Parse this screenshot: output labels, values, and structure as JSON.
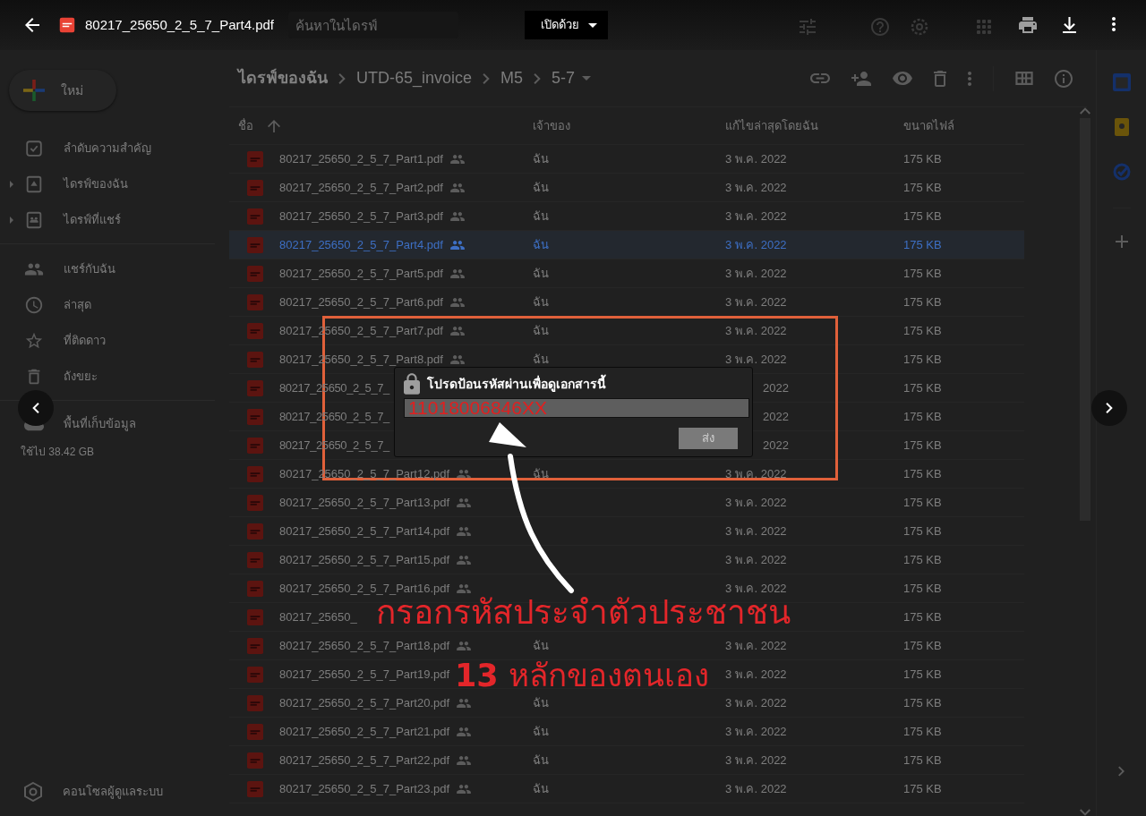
{
  "viewer": {
    "file_name": "80217_25650_2_5_7_Part4.pdf",
    "open_with": "เปิดด้วย"
  },
  "drive_header": {
    "search_placeholder": "ค้นหาในไดรฟ์"
  },
  "sidebar": {
    "new_button": "ใหม่",
    "groups": [
      [
        {
          "label": "ลำดับความสำคัญ"
        },
        {
          "label": "ไดรฟ์ของฉัน",
          "expanded": false
        },
        {
          "label": "ไดรฟ์ที่แชร์",
          "expanded": false
        }
      ],
      [
        {
          "label": "แชร์กับฉัน"
        },
        {
          "label": "ล่าสุด"
        },
        {
          "label": "ที่ติดดาว"
        },
        {
          "label": "ถังขยะ"
        }
      ]
    ],
    "storage": {
      "label": "พื้นที่เก็บข้อมูล",
      "used": "ใช้ไป 38.42 GB"
    },
    "admin": "คอนโซลผู้ดูแลระบบ"
  },
  "breadcrumb": [
    "ไดรฟ์ของฉัน",
    "UTD-65_invoice",
    "M5",
    "5-7"
  ],
  "table": {
    "columns": [
      "ชื่อ",
      "เจ้าของ",
      "แก้ไขล่าสุดโดยฉัน",
      "ขนาดไฟล์"
    ],
    "rows": [
      {
        "kind": "full",
        "name": "80217_25650_2_5_7_Part1.pdf",
        "owner": "ฉัน",
        "modified": "3 พ.ค. 2022",
        "size": "175 KB",
        "selected": false
      },
      {
        "kind": "full",
        "name": "80217_25650_2_5_7_Part2.pdf",
        "owner": "ฉัน",
        "modified": "3 พ.ค. 2022",
        "size": "175 KB",
        "selected": false
      },
      {
        "kind": "full",
        "name": "80217_25650_2_5_7_Part3.pdf",
        "owner": "ฉัน",
        "modified": "3 พ.ค. 2022",
        "size": "175 KB",
        "selected": false
      },
      {
        "kind": "full",
        "name": "80217_25650_2_5_7_Part4.pdf",
        "owner": "ฉัน",
        "modified": "3 พ.ค. 2022",
        "size": "175 KB",
        "selected": true
      },
      {
        "kind": "full",
        "name": "80217_25650_2_5_7_Part5.pdf",
        "owner": "ฉัน",
        "modified": "3 พ.ค. 2022",
        "size": "175 KB",
        "selected": false
      },
      {
        "kind": "full",
        "name": "80217_25650_2_5_7_Part6.pdf",
        "owner": "ฉัน",
        "modified": "3 พ.ค. 2022",
        "size": "175 KB",
        "selected": false
      },
      {
        "kind": "full",
        "name": "80217_25650_2_5_7_Part7.pdf",
        "owner": "ฉัน",
        "modified": "3 พ.ค. 2022",
        "size": "175 KB",
        "selected": false
      },
      {
        "kind": "full",
        "name": "80217_25650_2_5_7_Part8.pdf",
        "owner": "ฉัน",
        "modified": "3 พ.ค. 2022",
        "size": "175 KB",
        "selected": false
      },
      {
        "kind": "covered",
        "name": "80217_25650_2_5_7_",
        "modified": "2022",
        "size": "175 KB",
        "selected": false
      },
      {
        "kind": "covered",
        "name": "80217_25650_2_5_7_",
        "modified": "2022",
        "size": "175 KB",
        "selected": false
      },
      {
        "kind": "covered",
        "name": "80217_25650_2_5_7_",
        "modified": "2022",
        "size": "175 KB",
        "selected": false
      },
      {
        "kind": "full",
        "name": "80217_25650_2_5_7_Part12.pdf",
        "owner": "ฉัน",
        "modified": "3 พ.ค. 2022",
        "size": "175 KB",
        "selected": false
      },
      {
        "kind": "full",
        "name": "80217_25650_2_5_7_Part13.pdf",
        "modified": "3 พ.ค. 2022",
        "size": "175 KB",
        "selected": false
      },
      {
        "kind": "full",
        "name": "80217_25650_2_5_7_Part14.pdf",
        "modified": "3 พ.ค. 2022",
        "size": "175 KB",
        "selected": false
      },
      {
        "kind": "full",
        "name": "80217_25650_2_5_7_Part15.pdf",
        "modified": "3 พ.ค. 2022",
        "size": "175 KB",
        "selected": false
      },
      {
        "kind": "full",
        "name": "80217_25650_2_5_7_Part16.pdf",
        "modified": "3 พ.ค. 2022",
        "size": "175 KB",
        "selected": false
      },
      {
        "kind": "cut",
        "name": "80217_25650_",
        "size": "175 KB",
        "selected": false
      },
      {
        "kind": "full",
        "name": "80217_25650_2_5_7_Part18.pdf",
        "owner": "ฉัน",
        "modified": "3 พ.ค. 2022",
        "size": "175 KB",
        "selected": false
      },
      {
        "kind": "no_icon",
        "name": "80217_25650_2_5_7_Part19.pdf",
        "modified": "3 พ.ค. 2022",
        "size": "175 KB",
        "selected": false
      },
      {
        "kind": "full",
        "name": "80217_25650_2_5_7_Part20.pdf",
        "owner": "ฉัน",
        "modified": "3 พ.ค. 2022",
        "size": "175 KB",
        "selected": false
      },
      {
        "kind": "full",
        "name": "80217_25650_2_5_7_Part21.pdf",
        "owner": "ฉัน",
        "modified": "3 พ.ค. 2022",
        "size": "175 KB",
        "selected": false
      },
      {
        "kind": "full",
        "name": "80217_25650_2_5_7_Part22.pdf",
        "owner": "ฉัน",
        "modified": "3 พ.ค. 2022",
        "size": "175 KB",
        "selected": false
      },
      {
        "kind": "full",
        "name": "80217_25650_2_5_7_Part23.pdf",
        "owner": "ฉัน",
        "modified": "3 พ.ค. 2022",
        "size": "175 KB",
        "selected": false
      }
    ]
  },
  "dialog": {
    "title": "โปรดป้อนรหัสผ่านเพื่อดูเอกสารนี้",
    "value": "11018006846XX",
    "submit": "ส่ง"
  },
  "annotation": {
    "line_1": "กรอกรหัสประจำตัวประชาชน",
    "line_2": "**13** หลักของตนเอง"
  }
}
